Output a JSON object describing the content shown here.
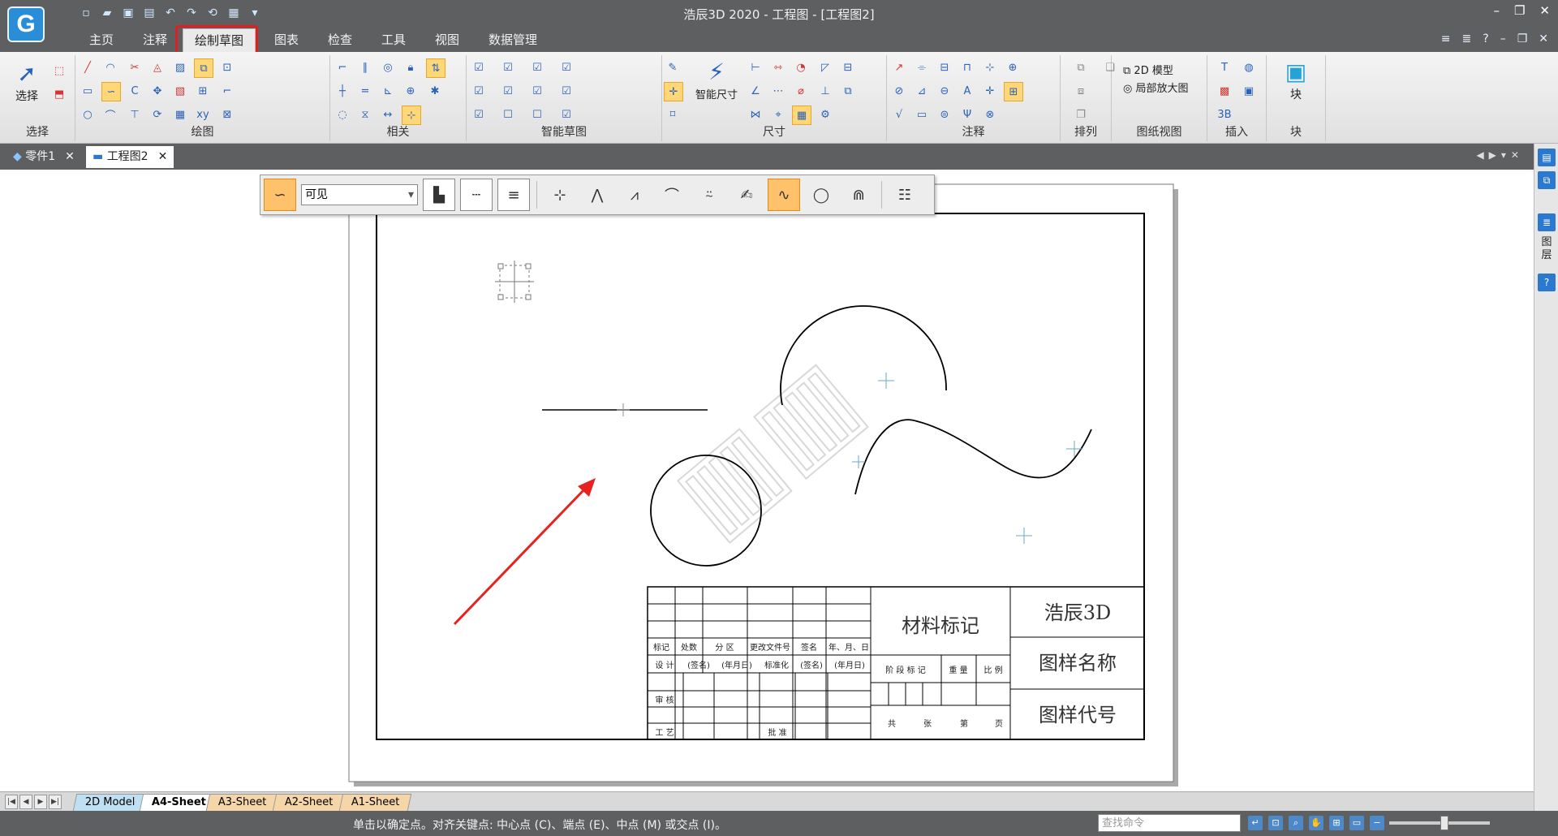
{
  "app": {
    "logo": "G",
    "title": "浩辰3D 2020 - 工程图 - [工程图2]",
    "window_controls": [
      "–",
      "❐",
      "✕"
    ]
  },
  "menu": {
    "tabs": [
      "主页",
      "注释",
      "绘制草图",
      "图表",
      "检查",
      "工具",
      "视图",
      "数据管理"
    ],
    "active": "绘制草图"
  },
  "ribbon": {
    "select_label": "选择",
    "groups": [
      "选择",
      "绘图",
      "相关",
      "智能草图",
      "尺寸",
      "注释",
      "排列",
      "图纸视图",
      "插入",
      "块"
    ],
    "smart_dimension_label": "智能尺寸",
    "model_2d_label": "2D 模型",
    "detail_view_label": "局部放大图",
    "block_label": "块"
  },
  "doc_tabs": [
    {
      "label": "零件1",
      "active": false
    },
    {
      "label": "工程图2",
      "active": true
    }
  ],
  "side_panel": {
    "text": "图层"
  },
  "float_toolbar": {
    "linestyle_value": "可见"
  },
  "title_block": {
    "material_mark": "材料标记",
    "company": "浩辰3D",
    "drawing_name": "图样名称",
    "drawing_code": "图样代号",
    "row_headers": [
      "标记",
      "处数",
      "分 区",
      "更改文件号",
      "签名",
      "年、月、日"
    ],
    "design_row": [
      "设 计",
      "(签名)",
      "(年月日)",
      "标准化",
      "(签名)",
      "(年月日)"
    ],
    "review": "审 核",
    "process": "工 艺",
    "approve": "批 准",
    "stage_row": [
      "阶 段 标 记",
      "重 量",
      "比 例"
    ],
    "sheet_row": [
      "共",
      "张",
      "第",
      "页"
    ]
  },
  "sheet_tabs": [
    "2D Model",
    "A4-Sheet",
    "A3-Sheet",
    "A2-Sheet",
    "A1-Sheet"
  ],
  "active_sheet": "A4-Sheet",
  "status": {
    "message": "单击以确定点。对齐关键点: 中心点 (C)、端点 (E)、中点 (M) 或交点 (I)。",
    "command_placeholder": "查找命令"
  },
  "colors": {
    "chrome": "#5d5f61",
    "accent_orange": "#ffc26b",
    "highlight_red": "#e02020",
    "arrow_red": "#e8231f"
  }
}
